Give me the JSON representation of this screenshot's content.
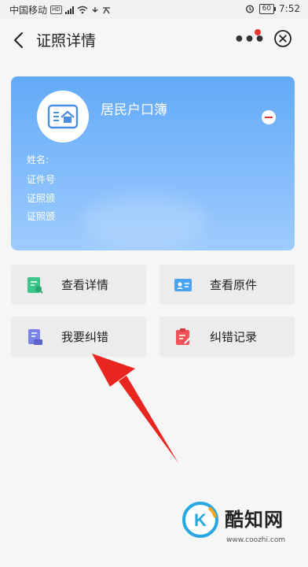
{
  "status_bar": {
    "carrier": "中国移动",
    "network_badge": "HD",
    "battery": "60",
    "time": "7:52"
  },
  "header": {
    "title": "证照详情",
    "more_glyph": "•••",
    "icons": {
      "back": "chevron-left-icon",
      "more": "more-dots-icon",
      "close": "close-circle-icon"
    }
  },
  "certificate": {
    "name": "居民户口簿",
    "icon": "household-register-icon",
    "fields": [
      {
        "label": "姓名:"
      },
      {
        "label": "证件号"
      },
      {
        "label": "证照颁"
      },
      {
        "label": "证照颁"
      }
    ]
  },
  "actions": [
    {
      "label": "查看详情",
      "icon": "document-view-icon",
      "color": "#3cc68a"
    },
    {
      "label": "查看原件",
      "icon": "id-card-icon",
      "color": "#4aa3f0"
    },
    {
      "label": "我要纠错",
      "icon": "stamp-icon",
      "color": "#7a83e6"
    },
    {
      "label": "纠错记录",
      "icon": "clipboard-edit-icon",
      "color": "#f0525a"
    }
  ],
  "annotation": {
    "arrow_color": "#e8251f"
  },
  "watermark": {
    "logo_letter": "K",
    "name": "酷知网",
    "url": "www.coozhi.com"
  }
}
